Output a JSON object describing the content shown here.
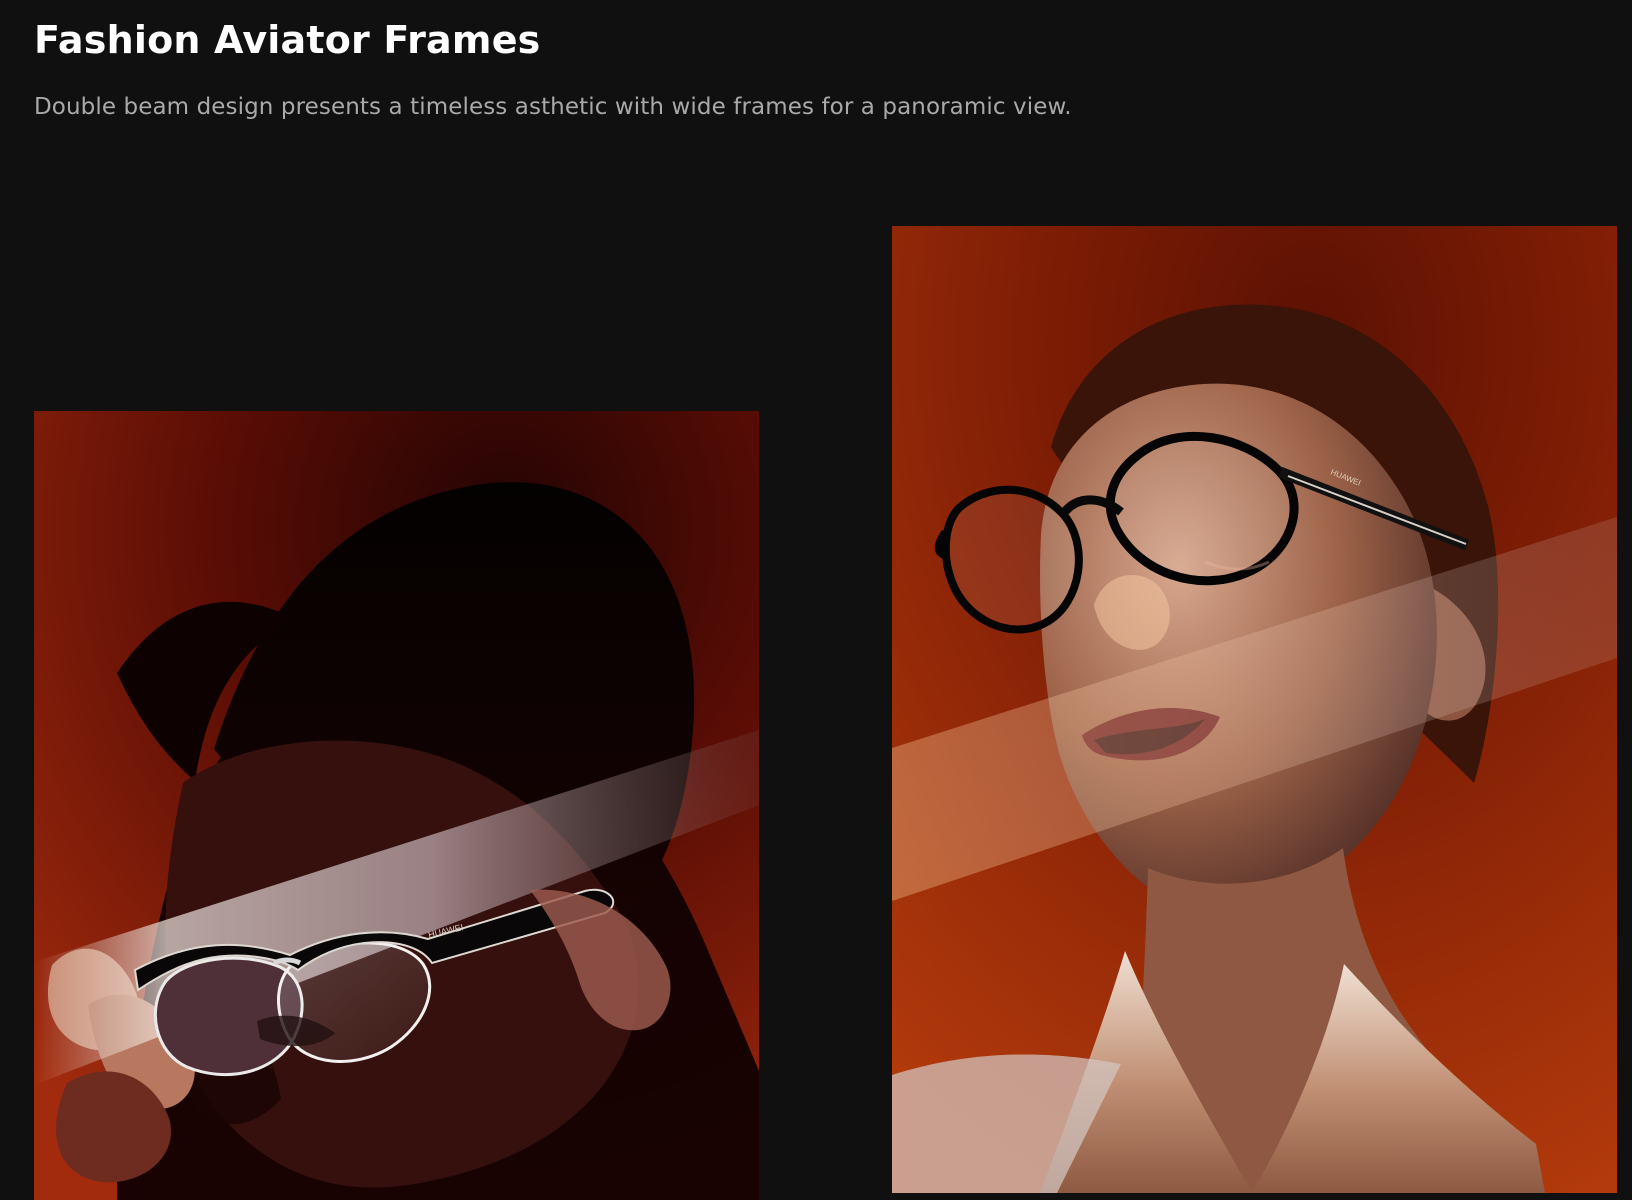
{
  "feature": {
    "title": "Fashion Aviator Frames",
    "description": "Double beam design presents a timeless asthetic with wide frames for a panoramic view."
  },
  "images": [
    {
      "name": "man-wearing-browline-glasses",
      "brand_text": "HUAWEI",
      "icon": "browline-glasses-icon"
    },
    {
      "name": "woman-wearing-round-glasses",
      "brand_text": "HUAWEI",
      "icon": "round-glasses-icon"
    }
  ],
  "colors": {
    "background": "#101010",
    "title": "#ffffff",
    "subtitle": "#a9a9a9",
    "left_backdrop": "#6d1208",
    "right_backdrop": "#8e2306"
  }
}
